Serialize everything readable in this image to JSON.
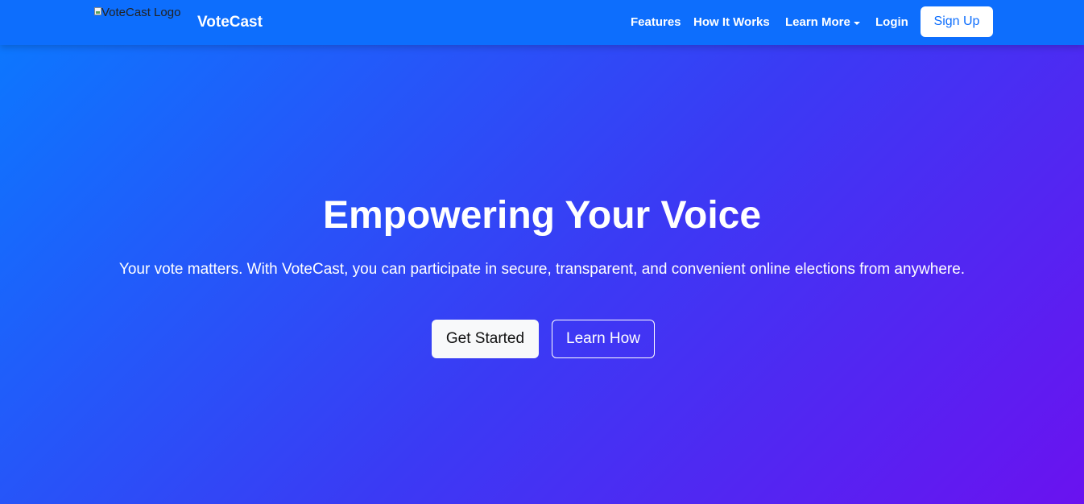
{
  "navbar": {
    "logo_alt": "VoteCast Logo",
    "brand_name": "VoteCast",
    "links": {
      "features": "Features",
      "how_it_works": "How It Works",
      "learn_more": "Learn More",
      "login": "Login"
    },
    "signup_label": "Sign Up",
    "icons": {
      "logo": "broken-image-icon",
      "learn_more_dropdown": "caret-down-icon"
    }
  },
  "hero": {
    "title": "Empowering Your Voice",
    "subtitle": "Your vote matters. With VoteCast, you can participate in secure, transparent, and convenient online elections from anywhere.",
    "primary_button": "Get Started",
    "secondary_button": "Learn How"
  },
  "colors": {
    "navbar_bg": "#0d6efd",
    "gradient_start": "#0a7aff",
    "gradient_mid": "#3b3af4",
    "gradient_end": "#6a12f0",
    "signup_text": "#0d6efd",
    "text_light": "#ffffff"
  }
}
